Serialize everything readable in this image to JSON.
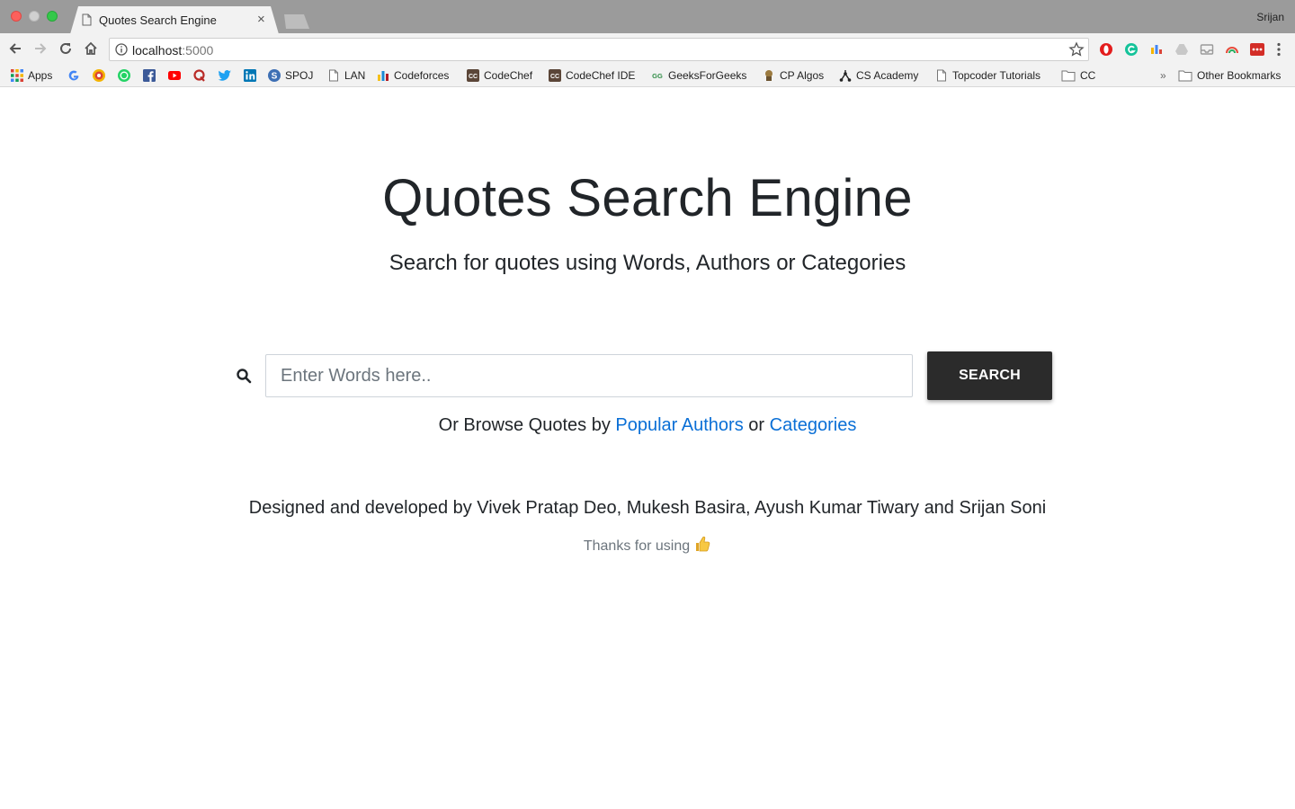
{
  "browser": {
    "tab_title": "Quotes Search Engine",
    "tab_close": "×",
    "profile_name": "Srijan",
    "url_host": "localhost",
    "url_port": ":5000"
  },
  "bookmarks": {
    "items": [
      {
        "label": "Apps",
        "icon": "apps-grid-icon"
      },
      {
        "label": "",
        "icon": "google-icon"
      },
      {
        "label": "",
        "icon": "chrome-extension-icon"
      },
      {
        "label": "",
        "icon": "whatsapp-icon"
      },
      {
        "label": "",
        "icon": "facebook-icon"
      },
      {
        "label": "",
        "icon": "youtube-icon"
      },
      {
        "label": "",
        "icon": "quora-icon"
      },
      {
        "label": "",
        "icon": "twitter-icon"
      },
      {
        "label": "",
        "icon": "linkedin-icon"
      },
      {
        "label": "SPOJ",
        "icon": "spoj-icon"
      },
      {
        "label": "LAN",
        "icon": "page-icon"
      },
      {
        "label": "Codeforces",
        "icon": "codeforces-icon"
      },
      {
        "label": "CodeChef",
        "icon": "codechef-icon"
      },
      {
        "label": "CodeChef IDE",
        "icon": "codechef-icon"
      },
      {
        "label": "GeeksForGeeks",
        "icon": "gfg-icon"
      },
      {
        "label": "CP Algos",
        "icon": "cp-algos-icon"
      },
      {
        "label": "CS Academy",
        "icon": "cs-academy-icon"
      },
      {
        "label": "Topcoder Tutorials",
        "icon": "page-icon"
      },
      {
        "label": "CC",
        "icon": "folder-icon"
      }
    ],
    "overflow": "»",
    "other_bookmarks": "Other Bookmarks"
  },
  "hero": {
    "title": "Quotes Search Engine",
    "subtitle": "Search for quotes using Words, Authors or Categories"
  },
  "search": {
    "placeholder": "Enter Words here..",
    "value": "",
    "button_label": "SEARCH"
  },
  "browse": {
    "prefix": "Or Browse Quotes by ",
    "authors_link": "Popular Authors",
    "middle": " or ",
    "categories_link": "Categories"
  },
  "footer": {
    "credits": "Designed and developed by Vivek Pratap Deo, Mukesh Basira, Ayush Kumar Tiwary and Srijan Soni",
    "thanks": "Thanks for using"
  },
  "colors": {
    "link": "#0a6fd6",
    "button_bg": "#2b2b2b",
    "text": "#212529"
  }
}
